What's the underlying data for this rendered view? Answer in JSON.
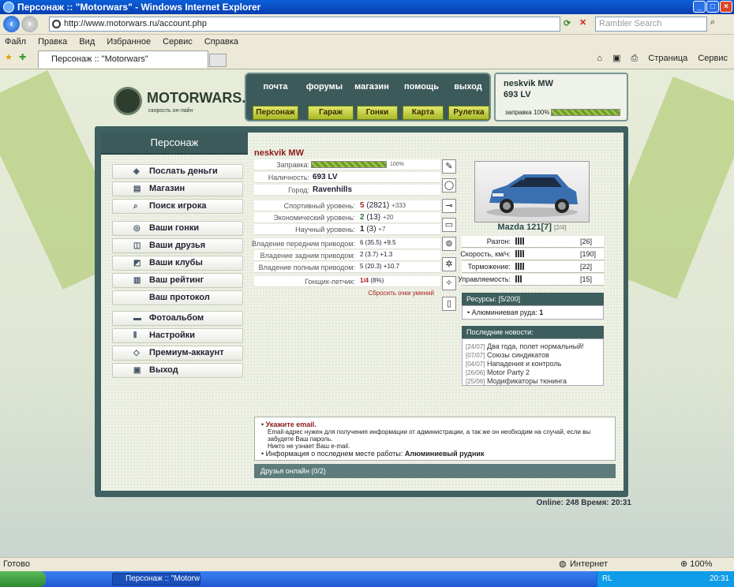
{
  "window": {
    "title": "Персонаж :: \"Motorwars\" - Windows Internet Explorer"
  },
  "browser": {
    "address": "http://www.motorwars.ru/account.php",
    "search_placeholder": "Rambler Search",
    "menu": [
      "Файл",
      "Правка",
      "Вид",
      "Избранное",
      "Сервис",
      "Справка"
    ],
    "tab_title": "Персонаж :: \"Motorwars\"",
    "tools": {
      "page": "Страница",
      "service": "Сервис"
    }
  },
  "site": {
    "logo": "MOTORWARS.RU",
    "tagline": "скорость он-лайн",
    "topnav": [
      "почта",
      "форумы",
      "магазин",
      "помощь",
      "выход"
    ],
    "subnav": [
      "Персонаж",
      "Гараж",
      "Гонки",
      "Карта",
      "Рулетка"
    ],
    "user": {
      "name": "neskvik MW",
      "money": "693 LV",
      "fuel_label": "заправка 100%",
      "fuel_fraction": 1.0
    }
  },
  "sidebar": {
    "title": "Персонаж",
    "items": [
      {
        "label": "Послать деньги",
        "icon": "tag-icon"
      },
      {
        "label": "Магазин",
        "icon": "cart-icon"
      },
      {
        "label": "Поиск игрока",
        "icon": "magnifier-icon"
      },
      {
        "label": "Ваши гонки",
        "icon": "wheel-icon"
      },
      {
        "label": "Ваши друзья",
        "icon": "people-icon"
      },
      {
        "label": "Ваши клубы",
        "icon": "club-icon"
      },
      {
        "label": "Ваш рейтинг",
        "icon": "bars-icon"
      },
      {
        "label": "Ваш протокол",
        "icon": ""
      },
      {
        "label": "Фотоальбом",
        "icon": "car-icon"
      },
      {
        "label": "Настройки",
        "icon": "sliders-icon"
      },
      {
        "label": "Премиум-аккаунт",
        "icon": "diamond-icon"
      },
      {
        "label": "Выход",
        "icon": "exit-icon"
      }
    ]
  },
  "character": {
    "name": "neskvik MW",
    "fuel": {
      "label": "Заправка:",
      "fraction": 1.0,
      "pct": "100%"
    },
    "cash": {
      "label": "Наличность:",
      "value": "693 LV"
    },
    "city": {
      "label": "Город:",
      "value": "Ravenhills"
    },
    "levels": [
      {
        "label": "Спортивный уровень:",
        "level": "5",
        "points": "(2821)",
        "delta": "+333",
        "color": "r"
      },
      {
        "label": "Экономический уровень:",
        "level": "2",
        "points": "(13)",
        "delta": "+20",
        "color": "g"
      },
      {
        "label": "Научный уровень:",
        "level": "1",
        "points": "(3)",
        "delta": "+7",
        "color": "b"
      }
    ],
    "drives": [
      {
        "label": "Владение передним приводом:",
        "value": "6 (35.5) +9.5"
      },
      {
        "label": "Владение задним приводом:",
        "value": "2 (3.7) +1.3"
      },
      {
        "label": "Владение полным приводом:",
        "value": "5 (20.3) +10.7"
      }
    ],
    "pilot": {
      "label": "Гонщик-летчик:",
      "value": "1/4",
      "extra": "(8%)"
    },
    "reset": "Сбросить очки умений"
  },
  "car": {
    "name": "Mazda 121[7]",
    "slot": "[2/4]",
    "stats": [
      {
        "label": "Разгон:",
        "value": "[26]"
      },
      {
        "label": "Скорость, км/ч:",
        "value": "[190]"
      },
      {
        "label": "Торможение:",
        "value": "[22]"
      },
      {
        "label": "Управляемость:",
        "value": "[15]"
      }
    ]
  },
  "resources": {
    "title": "Ресурсы: [5/200]",
    "item": "Алюминиевая руда:",
    "count": "1"
  },
  "news": {
    "title": "Последние новости:",
    "items": [
      {
        "date": "[24/07]",
        "text": "Два года, полет нормальный!"
      },
      {
        "date": "[07/07]",
        "text": "Союзы синдикатов"
      },
      {
        "date": "[04/07]",
        "text": "Нападения и контроль"
      },
      {
        "date": "[26/06]",
        "text": "Motor Party 2"
      },
      {
        "date": "[25/06]",
        "text": "Модификаторы тюнинга"
      }
    ]
  },
  "notice": {
    "title": "Укажите email.",
    "line1": "Email-адрес нужен для получения информации от администрации, а так же он необходим на случай, если вы забудете Ваш пароль.",
    "line2": "Никто не узнает Ваш e-mail.",
    "work_label": "Информация о последнем месте работы:",
    "work_value": "Алюминиевый рудник"
  },
  "friends": "Друзья онлайн (0/2)",
  "online": "Online: 248  Время: 20:31",
  "status": {
    "left": "Готово",
    "zone": "Интернет",
    "zoom": "100%"
  },
  "taskbar": {
    "task": "Персонаж :: \"Motorw...",
    "lang": "RL",
    "time": "20:31"
  }
}
